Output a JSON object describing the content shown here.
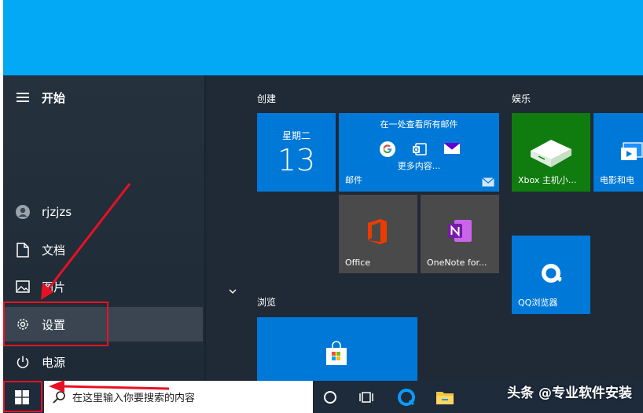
{
  "start_menu": {
    "title": "开始",
    "user": "rjzjzs",
    "documents": "文档",
    "pictures": "图片",
    "settings": "设置",
    "power": "电源"
  },
  "groups": {
    "create": "创建",
    "entertainment": "娱乐",
    "browse": "浏览"
  },
  "tiles": {
    "calendar_weekday": "星期二",
    "calendar_day": "13",
    "mail_heading": "在一处查看所有邮件",
    "mail_more": "更多内容...",
    "mail_label": "邮件",
    "office_label": "Office",
    "onenote_label": "OneNote for...",
    "xbox_label": "Xbox 主机小...",
    "movies_label": "电影和电",
    "qq_label": "QQ浏览器"
  },
  "taskbar": {
    "search_placeholder": "在这里输入你要搜索的内容"
  },
  "watermark": "头条 @专业软件安装",
  "colors": {
    "accent": "#0078d7",
    "annotation": "#e81123",
    "xbox_green": "#107c10",
    "desktop": "#03a9f4"
  }
}
